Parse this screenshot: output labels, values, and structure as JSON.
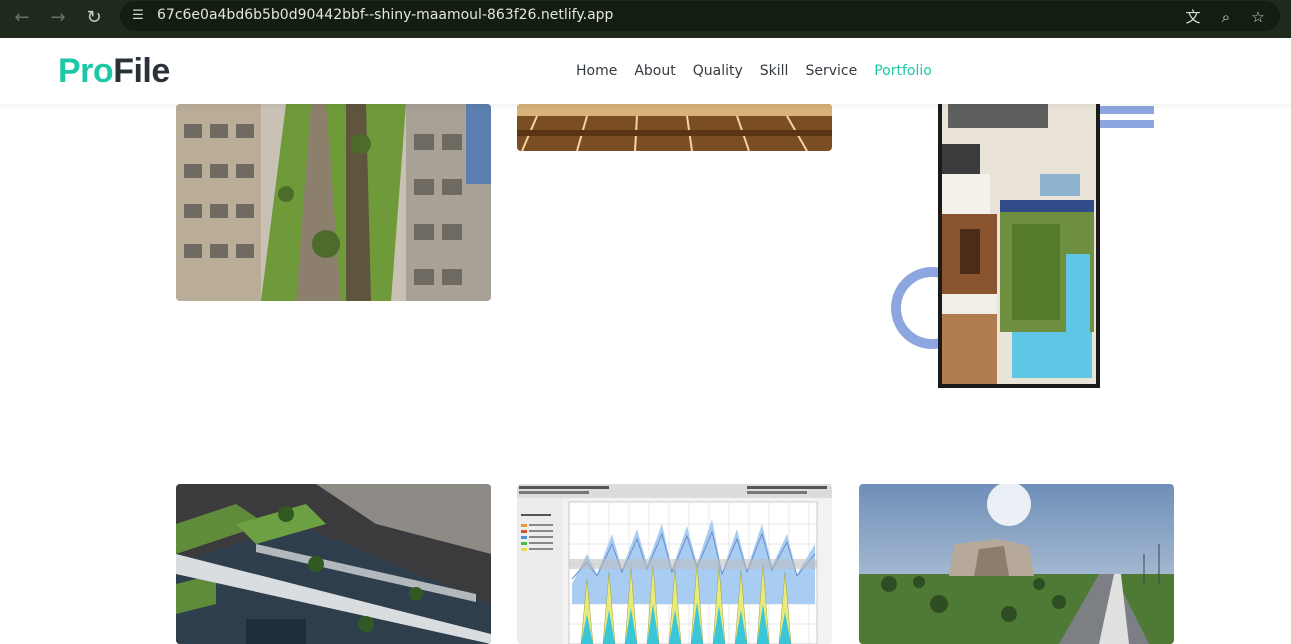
{
  "browser": {
    "back_icon": "arrow-left-icon",
    "forward_icon": "arrow-right-icon",
    "reload_icon": "reload-icon",
    "site_info_icon": "tune-icon",
    "url": "67c6e0a4bd6b5b0d90442bbf--shiny-maamoul-863f26.netlify.app",
    "translate_icon": "translate-icon",
    "zoom_icon": "zoom-icon",
    "bookmark_icon": "star-icon"
  },
  "header": {
    "logo_pro": "Pro",
    "logo_file": "File",
    "menu": [
      {
        "label": "Home"
      },
      {
        "label": "About"
      },
      {
        "label": "Quality"
      },
      {
        "label": "Skill"
      },
      {
        "label": "Service"
      },
      {
        "label": "Portfolio",
        "active": true
      }
    ]
  },
  "colors": {
    "accent": "#1ec7a6",
    "text_dark": "#2b3139",
    "browser_bar": "#1f2a1c",
    "decor_blue": "#8ea6e0"
  },
  "portfolio": {
    "items": [
      {
        "subject": "residential-courtyard-render"
      },
      {
        "subject": "interior-seating-render"
      },
      {
        "subject": "house-floor-plan"
      },
      {
        "subject": "bridge-aerial-render"
      },
      {
        "subject": "energy-analysis-chart"
      },
      {
        "subject": "building-landscape-render"
      }
    ]
  }
}
